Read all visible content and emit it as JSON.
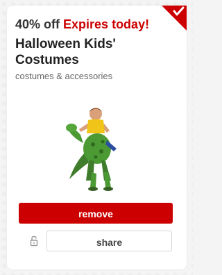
{
  "offer": {
    "discount": "40% off",
    "expires": "Expires today!"
  },
  "product": {
    "title": "Halloween Kids' Costumes",
    "category": "costumes & accessories",
    "image_icon": "child-dinosaur-costume-image"
  },
  "actions": {
    "remove_label": "remove",
    "share_label": "share",
    "lock_icon": "lock-icon",
    "added_icon": "checkmark-corner-icon"
  },
  "colors": {
    "accent": "#cc0000",
    "corner": "#cc0000"
  }
}
